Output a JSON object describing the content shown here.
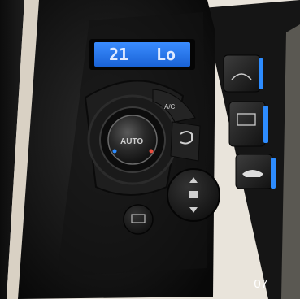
{
  "lcd": {
    "left_text": "21",
    "right_text": "Lo",
    "color": "#1f7bff"
  },
  "knob": {
    "label": "AUTO"
  },
  "buttons": {
    "ac_label": "A/C"
  },
  "page_number": "07",
  "colors": {
    "accent_blue": "#2d8cff",
    "bezel": "#141414",
    "background": "#e9e4db"
  }
}
